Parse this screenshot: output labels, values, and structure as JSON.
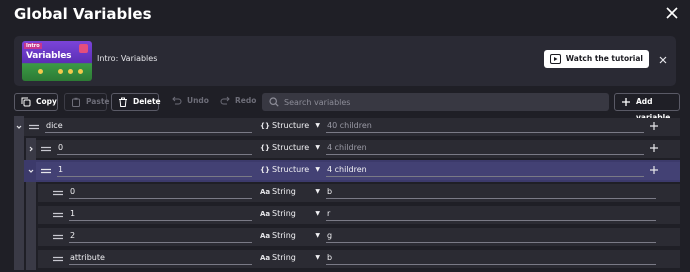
{
  "header": {
    "title": "Global Variables"
  },
  "banner": {
    "thumb_tag": "Intro",
    "thumb_word": "Variables",
    "title": "Intro: Variables",
    "watch_label": "Watch the tutorial"
  },
  "toolbar": {
    "copy_label": "Copy",
    "paste_label": "Paste",
    "delete_label": "Delete",
    "undo_label": "Undo",
    "redo_label": "Redo",
    "search_placeholder": "Search variables",
    "add_label": "Add variable"
  },
  "colors": {
    "background": "#1f1f26",
    "selected_row": "#434174",
    "row": "#2b2b33"
  },
  "rows": [
    {
      "name": "dice",
      "type_icon": "{}",
      "type": "Structure",
      "value": "40 children"
    },
    {
      "name": "0",
      "type_icon": "{}",
      "type": "Structure",
      "value": "4 children"
    },
    {
      "name": "1",
      "type_icon": "{}",
      "type": "Structure",
      "value": "4 children"
    },
    {
      "name": "0",
      "type_icon": "Aa",
      "type": "String",
      "value": "b"
    },
    {
      "name": "1",
      "type_icon": "Aa",
      "type": "String",
      "value": "r"
    },
    {
      "name": "2",
      "type_icon": "Aa",
      "type": "String",
      "value": "g"
    },
    {
      "name": "attribute",
      "type_icon": "Aa",
      "type": "String",
      "value": "b"
    }
  ]
}
